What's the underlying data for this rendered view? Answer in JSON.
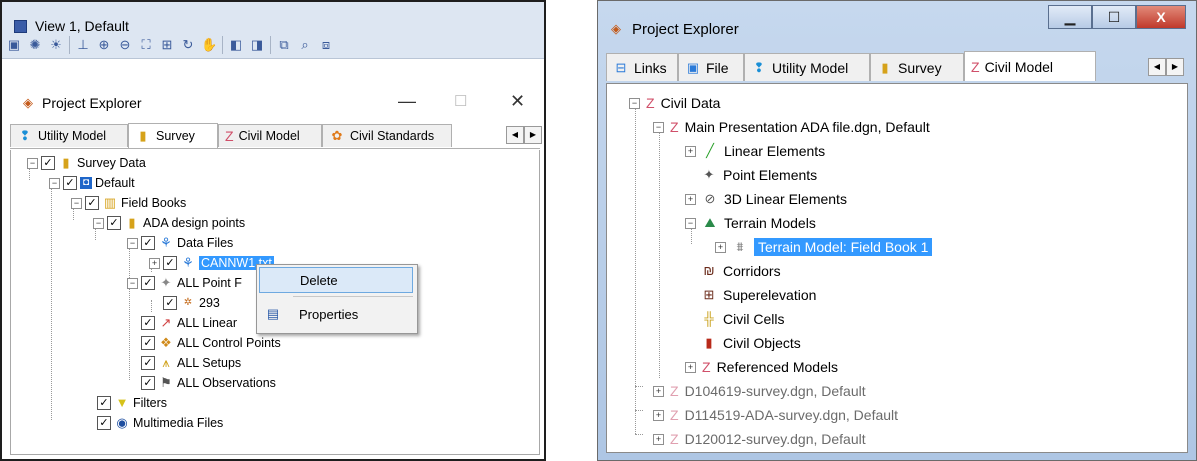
{
  "left": {
    "view_title": "View 1, Default",
    "panel_title": "Project Explorer",
    "window_buttons": {
      "minimize": "—",
      "maximize": "☐",
      "close": "✕"
    },
    "toolbar_icons": [
      "view-icon",
      "brightness-icon",
      "light-icon",
      "measure-icon",
      "zoom-in-icon",
      "zoom-out-icon",
      "fit-icon",
      "window-area-icon",
      "rotate-icon",
      "pan-icon",
      "view-previous-icon",
      "view-next-icon",
      "copy-view-icon",
      "camera-icon",
      "clip-icon"
    ],
    "tabs": [
      "Utility Model",
      "Survey",
      "Civil Model",
      "Civil Standards"
    ],
    "active_tab": "Survey",
    "tree": [
      {
        "label": "Survey Data"
      },
      {
        "label": "Default"
      },
      {
        "label": "Field Books"
      },
      {
        "label": "ADA design points"
      },
      {
        "label": "Data Files"
      },
      {
        "label": "CANNW1.txt"
      },
      {
        "label": "ALL Point F"
      },
      {
        "label": "293"
      },
      {
        "label": "ALL Linear"
      },
      {
        "label": "ALL Control Points"
      },
      {
        "label": "ALL Setups"
      },
      {
        "label": "ALL Observations"
      },
      {
        "label": "Filters"
      },
      {
        "label": "Multimedia Files"
      }
    ],
    "context_menu": {
      "delete": "Delete",
      "properties": "Properties"
    }
  },
  "right": {
    "title": "Project Explorer",
    "buttons": {
      "minimize": "▁",
      "maximize": "☐",
      "close": "X"
    },
    "tabs": [
      "Links",
      "File",
      "Utility Model",
      "Survey",
      "Civil Model"
    ],
    "active_tab": "Civil Model",
    "tree": [
      {
        "label": "Civil Data"
      },
      {
        "label": "Main Presentation ADA file.dgn, Default"
      },
      {
        "label": "Linear Elements"
      },
      {
        "label": "Point Elements"
      },
      {
        "label": "3D Linear Elements"
      },
      {
        "label": "Terrain Models"
      },
      {
        "label": "Terrain Model: Field Book 1"
      },
      {
        "label": "Corridors"
      },
      {
        "label": "Superelevation"
      },
      {
        "label": "Civil Cells"
      },
      {
        "label": "Civil Objects"
      },
      {
        "label": "Referenced Models"
      },
      {
        "label": "D104619-survey.dgn, Default"
      },
      {
        "label": "D114519-ADA-survey.dgn, Default"
      },
      {
        "label": "D120012-survey.dgn, Default"
      }
    ]
  },
  "colors": {
    "selection": "#3399ff",
    "menu_highlight": "#dbe9f8",
    "civil_icon": "#d0506a"
  }
}
